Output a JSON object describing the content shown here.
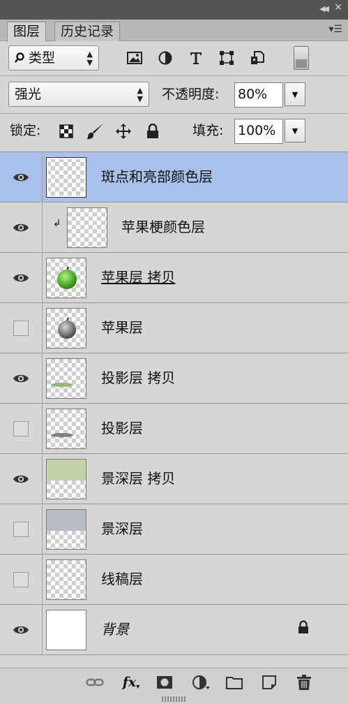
{
  "panel": {
    "tabs": [
      {
        "label": "图层",
        "active": true
      },
      {
        "label": "历史记录",
        "active": false
      }
    ]
  },
  "filter": {
    "kind_label": "类型",
    "icons": [
      "image-filter-icon",
      "adjustment-filter-icon",
      "type-filter-icon",
      "shape-filter-icon",
      "smart-object-filter-icon"
    ]
  },
  "blend": {
    "mode": "强光",
    "opacity_label": "不透明度:",
    "opacity_value": "80%"
  },
  "lock": {
    "label": "锁定:",
    "fill_label": "填充:",
    "fill_value": "100%"
  },
  "layers": [
    {
      "name": "斑点和亮部颜色层",
      "visible": true,
      "selected": true,
      "clipped": false
    },
    {
      "name": "苹果梗颜色层",
      "visible": true,
      "selected": false,
      "clipped": true
    },
    {
      "name": "苹果层 拷贝",
      "visible": true,
      "selected": false,
      "clipped": false
    },
    {
      "name": "苹果层",
      "visible": false,
      "selected": false,
      "clipped": false
    },
    {
      "name": "投影层 拷贝",
      "visible": true,
      "selected": false,
      "clipped": false
    },
    {
      "name": "投影层",
      "visible": false,
      "selected": false,
      "clipped": false
    },
    {
      "name": "景深层 拷贝",
      "visible": true,
      "selected": false,
      "clipped": false
    },
    {
      "name": "景深层",
      "visible": false,
      "selected": false,
      "clipped": false
    },
    {
      "name": "线稿层",
      "visible": false,
      "selected": false,
      "clipped": false
    },
    {
      "name": "背景",
      "visible": true,
      "selected": false,
      "clipped": false,
      "locked": true
    }
  ],
  "colors": {
    "selected_row": "#a9c1ea",
    "panel_bg": "#d6d6d6",
    "apple_green": "#5fbf3a",
    "depth_green": "#c2d3a8"
  }
}
